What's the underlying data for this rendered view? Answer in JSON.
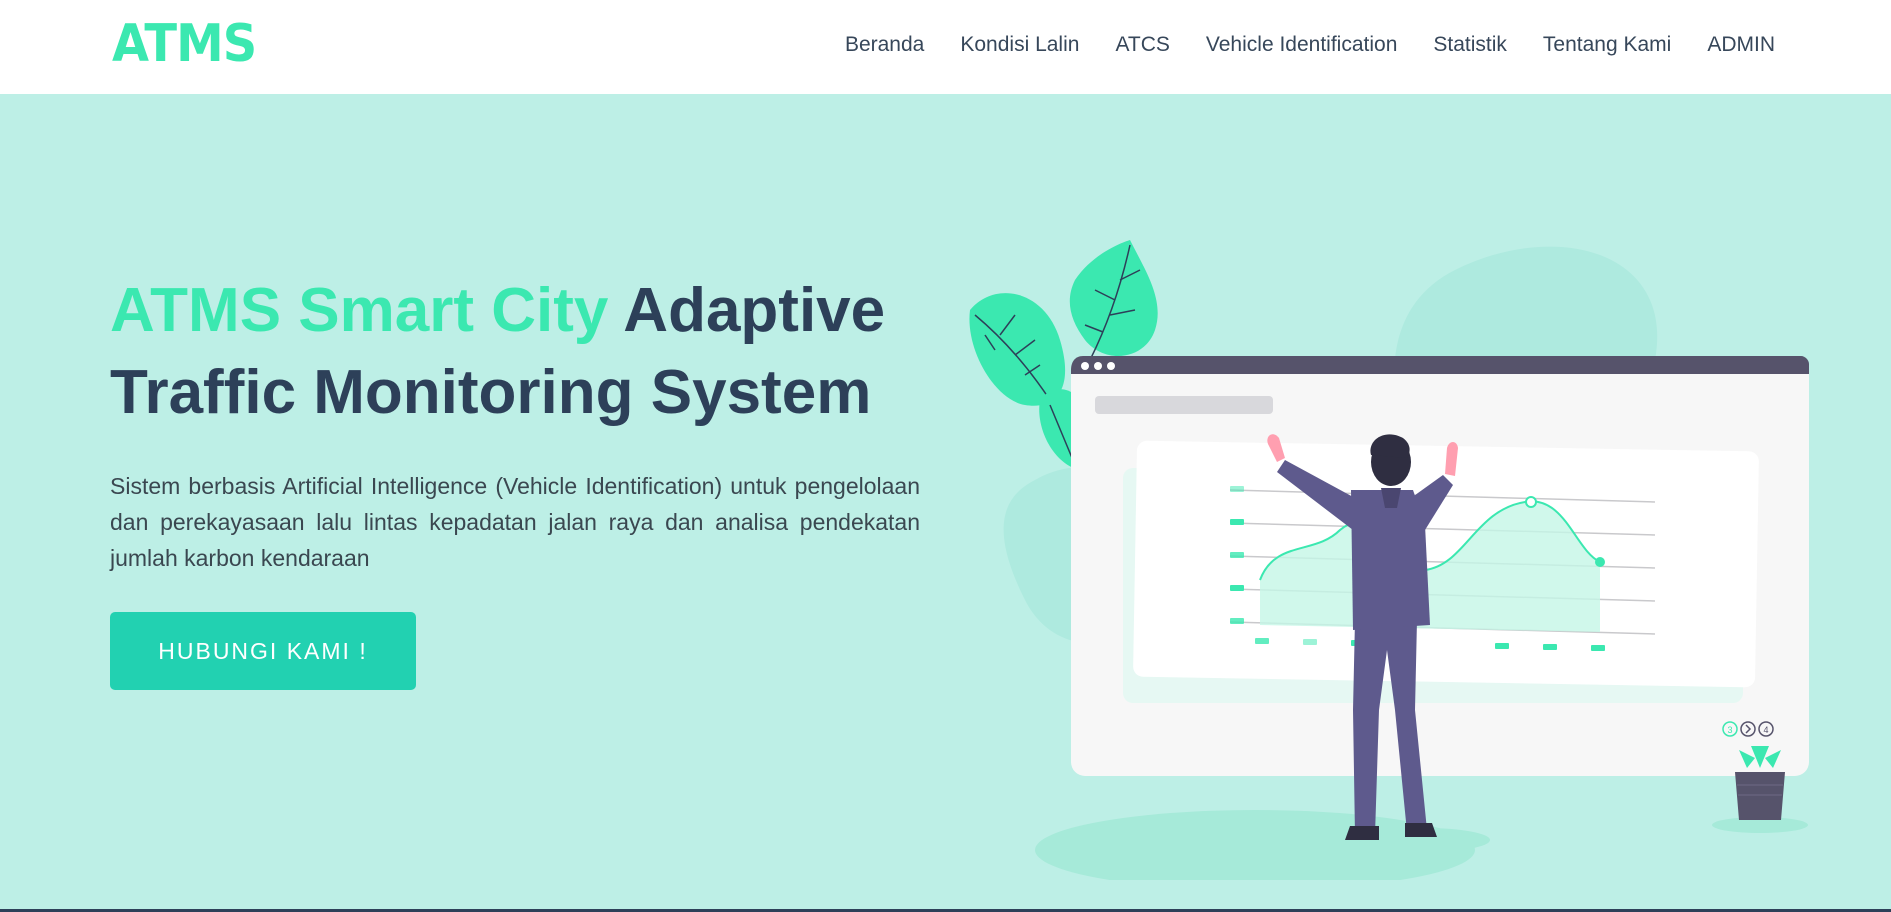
{
  "navbar": {
    "logo": "ATMS",
    "links": [
      "Beranda",
      "Kondisi Lalin",
      "ATCS",
      "Vehicle Identification",
      "Statistik",
      "Tentang Kami",
      "ADMIN"
    ]
  },
  "hero": {
    "headline_accent": "ATMS Smart City",
    "headline_rest": " Adaptive Traffic Monitoring System",
    "description": "Sistem berbasis Artificial Intelligence (Vehicle Identification) untuk pengelolaan dan perekayasaan lalu lintas kepadatan jalan raya dan analisa pendekatan jumlah karbon kendaraan",
    "cta_label": "HUBUNGI KAMI !"
  },
  "illustration": {
    "pager": [
      "3",
      "4"
    ]
  },
  "colors": {
    "accent": "#3be8b0",
    "button": "#22d1b1",
    "hero_bg": "#bdefe6",
    "heading": "#2d4059",
    "figure_suit": "#5e5a8d"
  }
}
